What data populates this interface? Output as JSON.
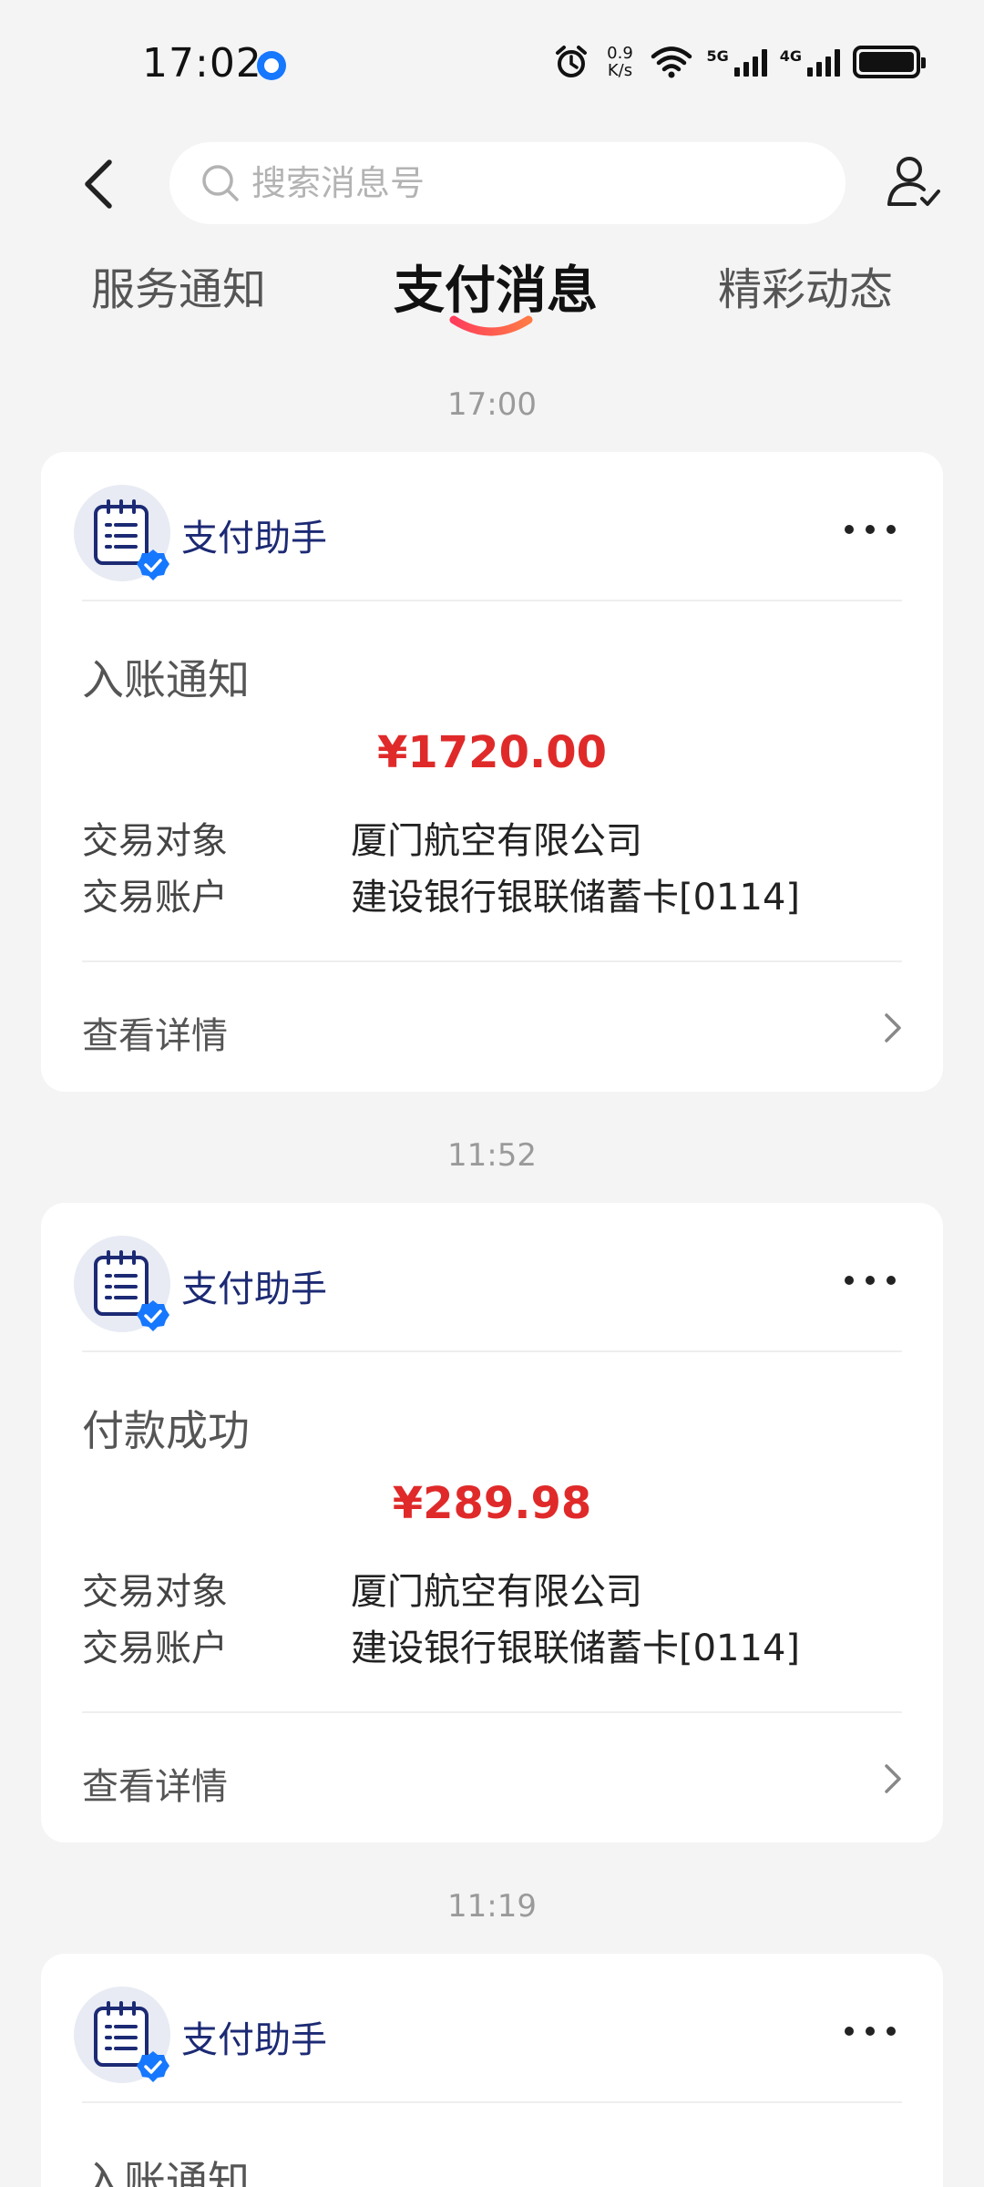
{
  "status_bar": {
    "time": "17:02",
    "net_speed_value": "0.9",
    "net_speed_unit": "K/s",
    "network_1": "5G",
    "network_2": "4G"
  },
  "header": {
    "search_placeholder": "搜索消息号"
  },
  "tabs": [
    {
      "label": "服务通知",
      "active": false
    },
    {
      "label": "支付消息",
      "active": true
    },
    {
      "label": "精彩动态",
      "active": false
    }
  ],
  "colors": {
    "accent": "#1677ff",
    "amount": "#e02a2a",
    "sender": "#1c2a74",
    "tab_indicator_start": "#ff3d5c",
    "tab_indicator_end": "#ff7a45"
  },
  "messages": [
    {
      "time": "17:00",
      "sender": "支付助手",
      "title": "入账通知",
      "amount": "¥1720.00",
      "counterparty_label": "交易对象",
      "counterparty": "厦门航空有限公司",
      "account_label": "交易账户",
      "account": "建设银行银联储蓄卡[0114]",
      "details_label": "查看详情"
    },
    {
      "time": "11:52",
      "sender": "支付助手",
      "title": "付款成功",
      "amount": "¥289.98",
      "counterparty_label": "交易对象",
      "counterparty": "厦门航空有限公司",
      "account_label": "交易账户",
      "account": "建设银行银联储蓄卡[0114]",
      "details_label": "查看详情"
    },
    {
      "time": "11:19",
      "sender": "支付助手",
      "title": "入账通知"
    }
  ]
}
